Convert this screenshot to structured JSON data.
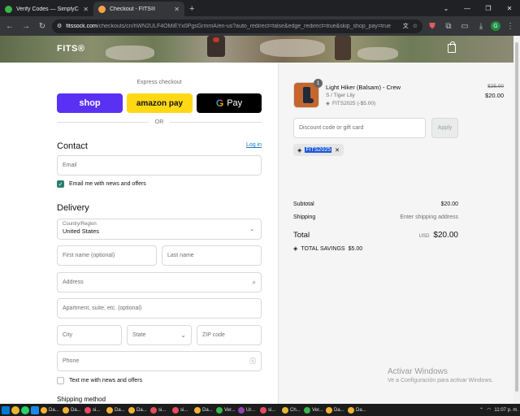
{
  "browser": {
    "tabs": [
      {
        "title": "Verify Codes — SimplyCodes",
        "color": "#3bb54a"
      },
      {
        "title": "Checkout - FITS®",
        "color": "#f4a442"
      }
    ],
    "new_tab": "+",
    "url_host": "fitssock.com",
    "url_path": "/checkouts/cn/hWN2ULF4OMiEYx0PgsGrmmA/en-us?auto_redirect=false&edge_redirect=true&skip_shop_pay=true",
    "profile_initial": "G"
  },
  "header": {
    "brand": "FITS®"
  },
  "checkout": {
    "express_title": "Express checkout",
    "shop_pay": "shop",
    "amazon_pay": "amazon pay",
    "google_pay_g": "G",
    "google_pay": "Pay",
    "or": "OR",
    "contact_title": "Contact",
    "login": "Log in",
    "email_placeholder": "Email",
    "email_offers": "Email me with news and offers",
    "delivery_title": "Delivery",
    "country_label": "Country/Region",
    "country_value": "United States",
    "first_name": "First name (optional)",
    "last_name": "Last name",
    "address": "Address",
    "apartment": "Apartment, suite, etc. (optional)",
    "city": "City",
    "state": "State",
    "zip": "ZIP code",
    "phone": "Phone",
    "text_offers": "Text me with news and offers",
    "shipping_method": "Shipping method"
  },
  "summary": {
    "qty": "1",
    "product_name": "Light Hiker (Balsam) - Crew",
    "variant": "S / Tiger Lily",
    "item_discount": "FITS2025 (-$5.00)",
    "old_price": "$25.00",
    "price": "$20.00",
    "discount_placeholder": "Discount code or gift card",
    "apply": "Apply",
    "applied_code": "FITS2025",
    "subtotal_label": "Subtotal",
    "subtotal": "$20.00",
    "shipping_label": "Shipping",
    "shipping": "Enter shipping address",
    "total_label": "Total",
    "currency": "USD",
    "total": "$20.00",
    "savings_label": "TOTAL SAVINGS",
    "savings": "$5.00"
  },
  "watermark": {
    "line1": "Activar Windows",
    "line2": "Ve a Configuración para activar Windows."
  },
  "taskbar": {
    "apps": [
      "Da...",
      "Da...",
      "si...",
      "Da...",
      "Da...",
      "si...",
      "si...",
      "Da...",
      "Ver...",
      "Ur...",
      "si...",
      "Ch...",
      "Ver...",
      "Da...",
      "Da..."
    ],
    "time": "11:07 p. m."
  }
}
